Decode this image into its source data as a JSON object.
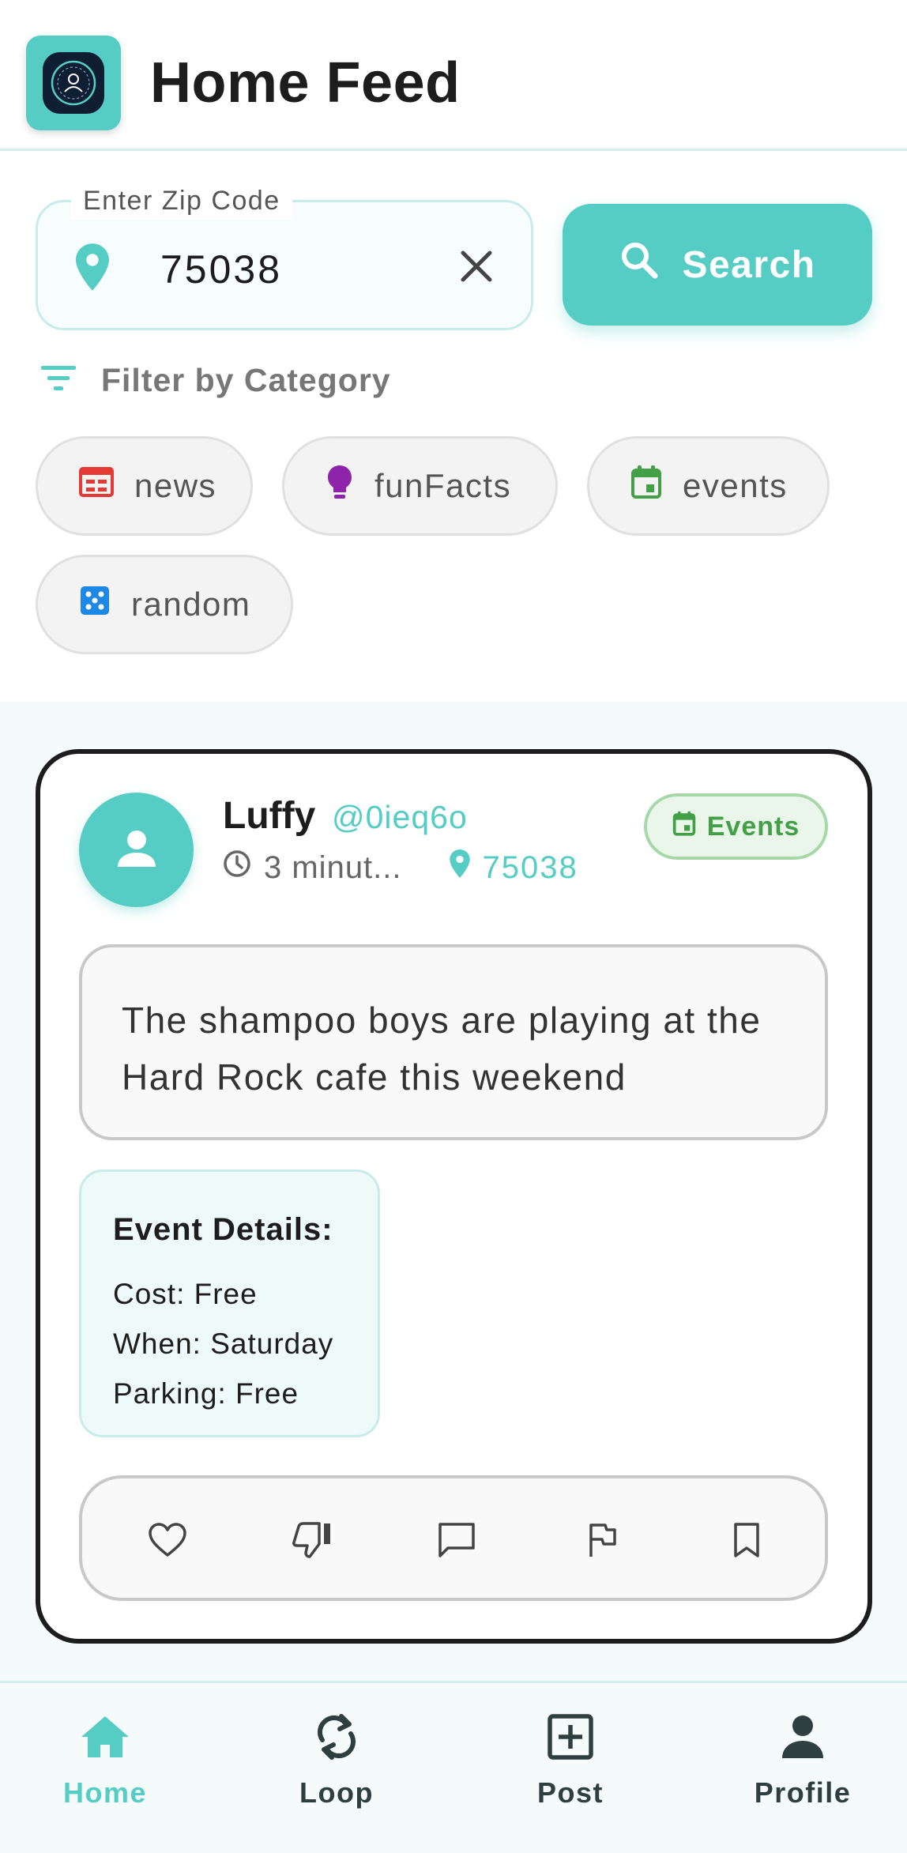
{
  "header": {
    "title": "Home Feed",
    "logo_icon": "app-logo-icon"
  },
  "search": {
    "zip_label": "Enter Zip Code",
    "zip_value": "75038",
    "button_label": "Search"
  },
  "filter": {
    "label": "Filter by Category",
    "chips": [
      {
        "label": "news",
        "icon": "newspaper-icon",
        "color": "#e53935"
      },
      {
        "label": "funFacts",
        "icon": "lightbulb-icon",
        "color": "#8e24aa"
      },
      {
        "label": "events",
        "icon": "calendar-icon",
        "color": "#43a047"
      },
      {
        "label": "random",
        "icon": "dice-icon",
        "color": "#1e88e5"
      }
    ]
  },
  "post": {
    "user_name": "Luffy",
    "handle": "@0ieq6o",
    "time": "3 minut...",
    "zip": "75038",
    "badge": "Events",
    "text": "The shampoo boys are playing at the Hard Rock cafe this weekend",
    "event_details": {
      "title": "Event Details:",
      "cost": "Cost: Free",
      "when": "When: Saturday",
      "parking": "Parking: Free"
    }
  },
  "nav": {
    "items": [
      {
        "label": "Home",
        "icon": "home-icon",
        "active": true
      },
      {
        "label": "Loop",
        "icon": "loop-icon",
        "active": false
      },
      {
        "label": "Post",
        "icon": "add-box-icon",
        "active": false
      },
      {
        "label": "Profile",
        "icon": "person-icon",
        "active": false
      }
    ]
  },
  "colors": {
    "accent": "#55cdc4",
    "text": "#1d1d1d",
    "events_green": "#43a047"
  }
}
